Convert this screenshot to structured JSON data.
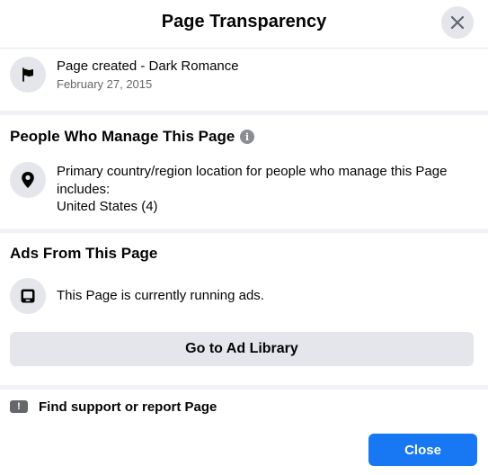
{
  "dialog": {
    "title": "Page Transparency",
    "close_icon": "close-icon"
  },
  "page_info": {
    "icon": "flag-icon",
    "created_label": "Page created - Dark Romance",
    "created_date": "February 27, 2015"
  },
  "managers": {
    "title": "People Who Manage This Page",
    "info_icon": "info-icon",
    "info_glyph": "i",
    "location_icon": "location-pin-icon",
    "description": "Primary country/region location for people who manage this Page includes:",
    "countries": "United States (4)"
  },
  "ads": {
    "title": "Ads From This Page",
    "icon": "ad-screen-icon",
    "status": "This Page is currently running ads.",
    "button_label": "Go to Ad Library"
  },
  "report": {
    "icon": "report-icon",
    "glyph": "!",
    "label": "Find support or report Page"
  },
  "footer": {
    "close_label": "Close"
  },
  "colors": {
    "accent": "#1877f2",
    "icon_bg": "#e4e6eb",
    "separator": "#f0f2f5",
    "secondary_text": "#65676b"
  }
}
